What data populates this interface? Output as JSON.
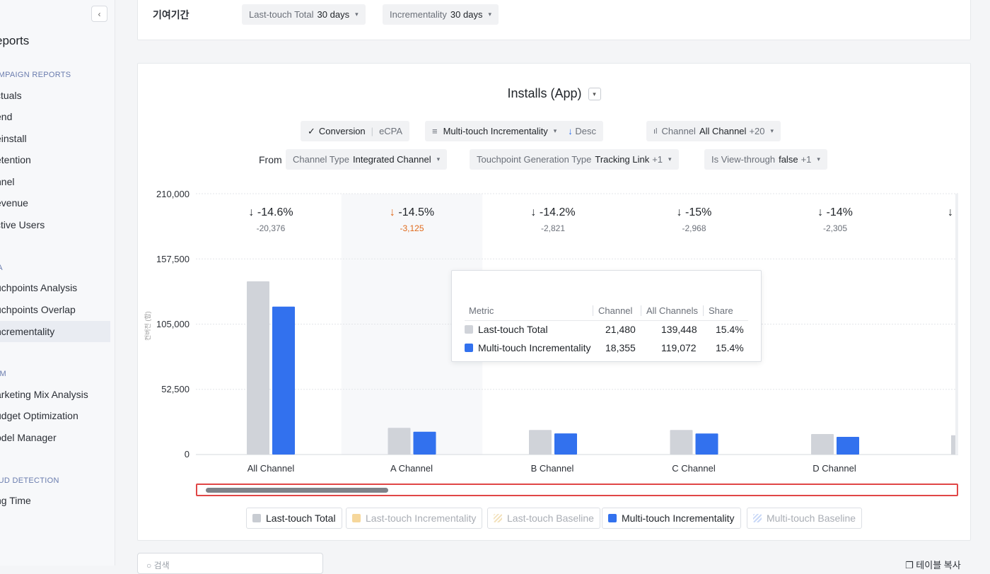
{
  "sidebar": {
    "title": "eports",
    "sections": [
      {
        "label": "AMPAIGN REPORTS",
        "items": [
          "ctuals",
          "end",
          "einstall",
          "etention",
          "nnel",
          "evenue",
          "ctive Users"
        ]
      },
      {
        "label": "TA",
        "items": [
          "uchpoints Analysis",
          "uchpoints Overlap",
          "ncrementality"
        ]
      },
      {
        "label": "MM",
        "items": [
          "arketing Mix Analysis",
          "udget Optimization",
          "odel Manager"
        ]
      },
      {
        "label": "AUD DETECTION",
        "items": [
          "ng Time"
        ]
      }
    ],
    "active_item": "ncrementality"
  },
  "attribution": {
    "label": "기여기간",
    "lt_name": "Last-touch Total",
    "lt_value": "30 days",
    "inc_name": "Incrementality",
    "inc_value": "30 days"
  },
  "chart_header": {
    "title": "Installs (App)",
    "conversion": "Conversion",
    "ecpa": "eCPA",
    "sort_metric": "Multi-touch Incrementality",
    "sort_dir": "Desc",
    "channel_label": "Channel",
    "channel_value": "All Channel",
    "channel_extra": "+20"
  },
  "filters": {
    "from": "From",
    "channel_type_label": "Channel Type",
    "channel_type_value": "Integrated Channel",
    "tgt_label": "Touchpoint Generation Type",
    "tgt_value": "Tracking Link",
    "tgt_extra": "+1",
    "vt_label": "Is View-through",
    "vt_value": "false",
    "vt_extra": "+1"
  },
  "chart_data": {
    "type": "bar",
    "ylabel": "컨버전 (합)",
    "ylim": [
      0,
      210000
    ],
    "yticks": [
      "210,000",
      "157,500",
      "105,000",
      "52,500",
      "0"
    ],
    "categories": [
      "All Channel",
      "A Channel",
      "B Channel",
      "C Channel",
      "D Channel"
    ],
    "series": [
      {
        "name": "Last-touch Total",
        "color": "#d0d3d9",
        "values": [
          139448,
          21480,
          19800,
          19800,
          16500
        ]
      },
      {
        "name": "Multi-touch Incrementality",
        "color": "#3271ee",
        "values": [
          119072,
          18355,
          17000,
          16900,
          14200
        ]
      }
    ],
    "deltas": [
      {
        "pct": "-14.6%",
        "abs": "-20,376"
      },
      {
        "pct": "-14.5%",
        "abs": "-3,125"
      },
      {
        "pct": "-14.2%",
        "abs": "-2,821"
      },
      {
        "pct": "-15%",
        "abs": "-2,968"
      },
      {
        "pct": "-14%",
        "abs": "-2,305"
      }
    ]
  },
  "tooltip": {
    "headers": [
      "Metric",
      "Channel",
      "All Channels",
      "Share"
    ],
    "rows": [
      {
        "metric": "Last-touch Total",
        "channel": "21,480",
        "all": "139,448",
        "share": "15.4%",
        "color": "#d0d3d9"
      },
      {
        "metric": "Multi-touch Incrementality",
        "channel": "18,355",
        "all": "119,072",
        "share": "15.4%",
        "color": "#3271ee"
      }
    ]
  },
  "legend": [
    {
      "label": "Last-touch Total",
      "color": "#c8ccd2",
      "active": true
    },
    {
      "label": "Last-touch Incrementality",
      "color": "#f6d79b",
      "active": false
    },
    {
      "label": "Last-touch Baseline",
      "color": "#f3e2bd",
      "active": false
    },
    {
      "label": "Multi-touch Incrementality",
      "color": "#3271ee",
      "active": true
    },
    {
      "label": "Multi-touch Baseline",
      "color": "#c9d8f7",
      "active": false
    }
  ],
  "search": {
    "placeholder": "검색"
  },
  "copy_table": "테이블 복사"
}
